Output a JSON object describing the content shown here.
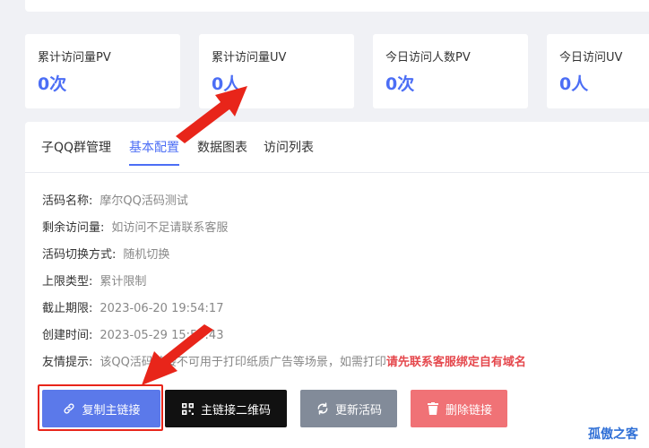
{
  "stats": [
    {
      "label": "累计访问量PV",
      "value": "0次"
    },
    {
      "label": "累计访问量UV",
      "value": "0人"
    },
    {
      "label": "今日访问人数PV",
      "value": "0次"
    },
    {
      "label": "今日访问UV",
      "value": "0人"
    }
  ],
  "tabs": [
    "子QQ群管理",
    "基本配置",
    "数据图表",
    "访问列表"
  ],
  "active_tab": "基本配置",
  "info": {
    "name_label": "活码名称:",
    "name_value": "摩尔QQ活码测试",
    "remaining_label": "剩余访问量:",
    "remaining_value": "如访问不足请联系客服",
    "switch_label": "活码切换方式:",
    "switch_value": "随机切换",
    "limit_label": "上限类型:",
    "limit_value": "累计限制",
    "deadline_label": "截止期限:",
    "deadline_value": "2023-06-20 19:54:17",
    "created_label": "创建时间:",
    "created_value": "2023-05-29 15:50:43",
    "tip_label": "友情提示:",
    "tip_value": "该QQ活码链接不可用于打印纸质广告等场景，如需打印",
    "tip_highlight": "请先联系客服绑定自有域名"
  },
  "buttons": {
    "copy": "复制主链接",
    "qr": "主链接二维码",
    "refresh": "更新活码",
    "delete": "删除链接"
  },
  "icons": {
    "copy": "link-icon",
    "qr": "qrcode-icon",
    "refresh": "refresh-icon",
    "delete": "trash-icon"
  },
  "colors": {
    "accent": "#4c6ef5",
    "copy_button": "#5b79ea",
    "qr_button": "#111111",
    "refresh_button": "#828b99",
    "delete_button": "#f07276",
    "annotation": "#e8251a",
    "warning_text": "#e5484d"
  },
  "watermark": "孤傲之客"
}
